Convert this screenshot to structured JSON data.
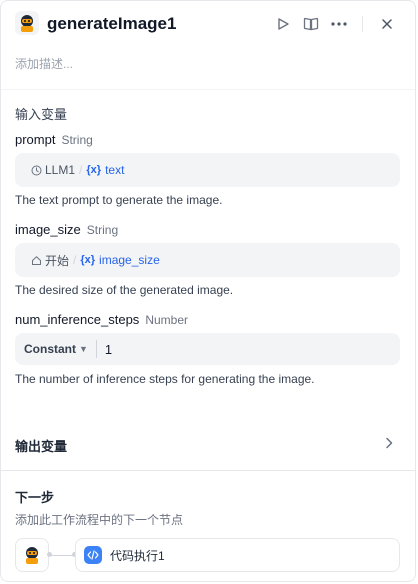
{
  "header": {
    "node_icon": "bot-avatar-icon",
    "title": "generateImage1",
    "actions": [
      "run-icon",
      "split-view-icon",
      "more-icon",
      "close-icon"
    ]
  },
  "description_placeholder": "添加描述...",
  "inputs": {
    "section_title": "输入变量",
    "prompt": {
      "name": "prompt",
      "type": "String",
      "ref_source": "LLM1",
      "ref_source_icon": "llm-icon",
      "ref_var": "text",
      "description": "The text prompt to generate the image."
    },
    "image_size": {
      "name": "image_size",
      "type": "String",
      "ref_source": "开始",
      "ref_source_icon": "home-icon",
      "ref_var": "image_size",
      "description": "The desired size of the generated image."
    },
    "num_inference_steps": {
      "name": "num_inference_steps",
      "type": "Number",
      "mode": "Constant",
      "value": "1",
      "description": "The number of inference steps for generating the image."
    }
  },
  "outputs": {
    "section_title": "输出变量"
  },
  "next_step": {
    "title": "下一步",
    "subtitle": "添加此工作流程中的下一个节点",
    "next_node_label": "代码执行1",
    "next_node_icon": "code-icon"
  },
  "colors": {
    "accent": "#2563eb",
    "code_node": "#3b82f6"
  }
}
